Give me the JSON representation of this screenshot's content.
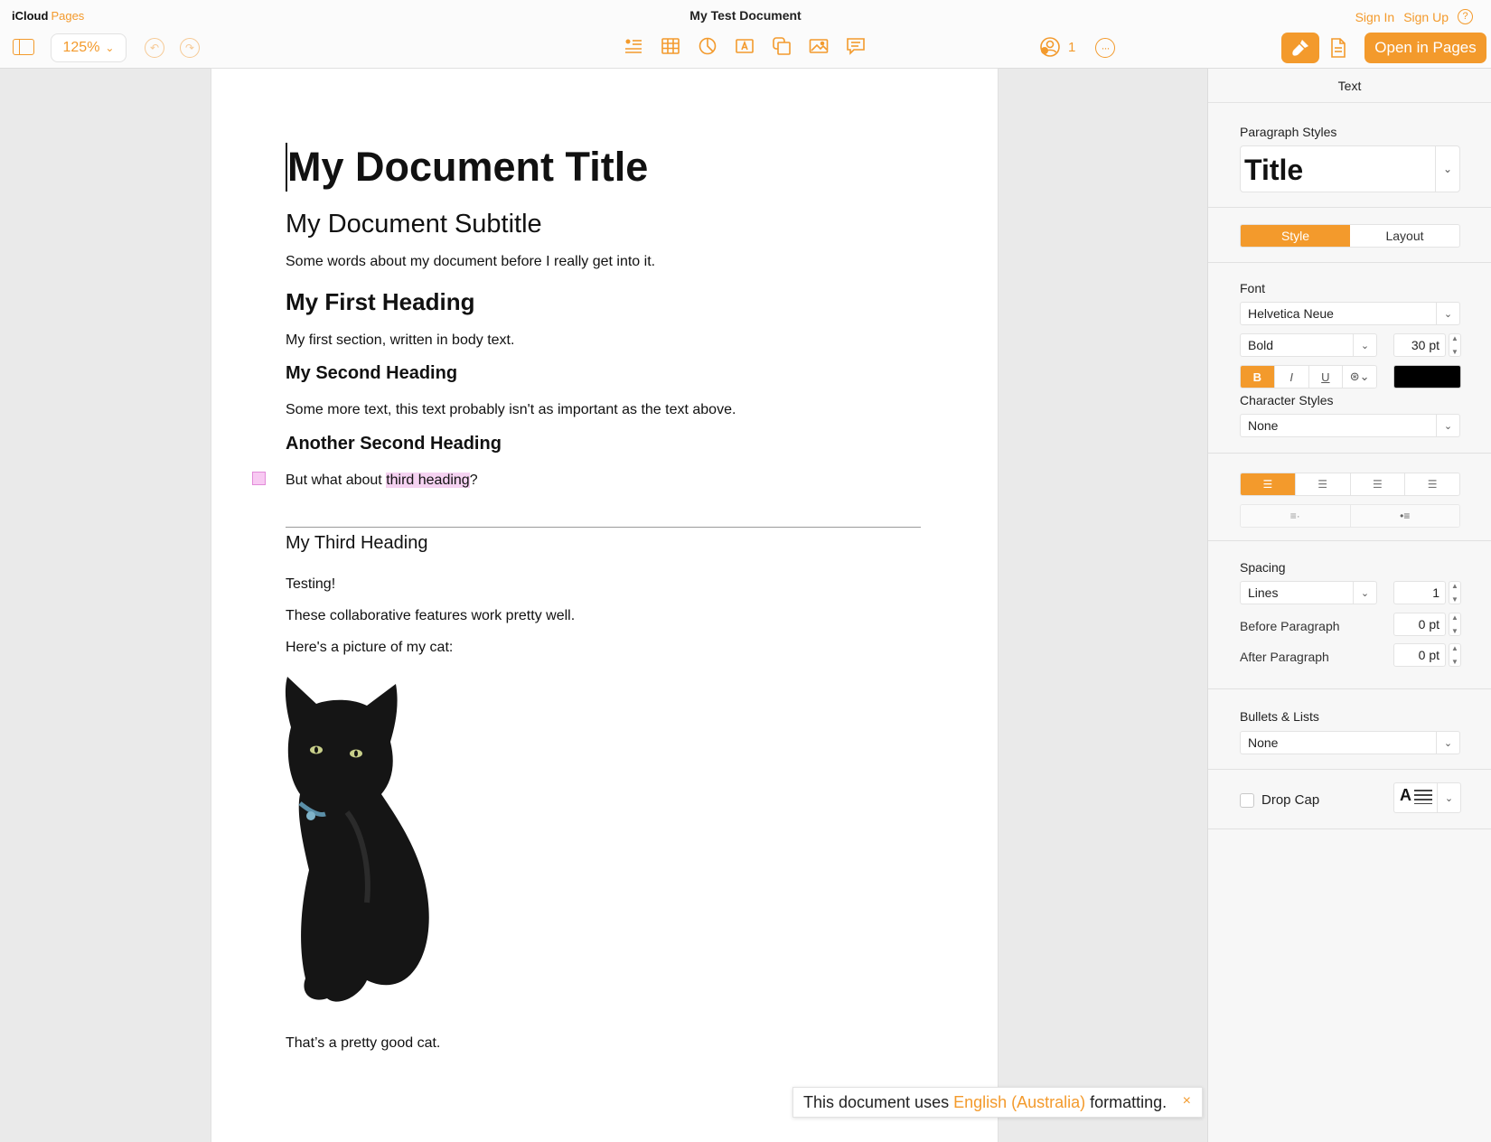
{
  "app": {
    "brand_primary": "iCloud",
    "brand_secondary": "Pages",
    "document_title": "My Test Document",
    "accent_color": "#f39a2c"
  },
  "auth": {
    "sign_in": "Sign In",
    "sign_up": "Sign Up",
    "help_icon": "?"
  },
  "toolbar": {
    "zoom": "125%",
    "collaborator_count": "1",
    "open_button": "Open in Pages",
    "insert_icons": [
      "text-list-icon",
      "table-icon",
      "chart-icon",
      "text-box-icon",
      "shape-icon",
      "media-icon",
      "comment-icon"
    ]
  },
  "document": {
    "title": "My Document Title",
    "subtitle": "My Document Subtitle",
    "intro": "Some words about my document before I really get into it.",
    "heading1": "My First Heading",
    "body1": "My first section, written in body text.",
    "heading2a": "My Second Heading",
    "body2": "Some more text, this text probably isn't as important as the text above.",
    "heading2b": "Another Second Heading",
    "comment_line_prefix": "But what about ",
    "comment_line_highlight": "third heading",
    "comment_line_suffix": "?",
    "heading3": "My Third Heading",
    "line_testing": "Testing!",
    "line_collab": "These collaborative features work pretty well.",
    "line_picture": "Here's a picture of my cat:",
    "line_after": "That’s a pretty good cat."
  },
  "toast": {
    "prefix": "This document uses",
    "locale": "English (Australia)",
    "suffix": "formatting.",
    "close": "×"
  },
  "inspector": {
    "header": "Text",
    "paragraph_styles_label": "Paragraph Styles",
    "paragraph_style": "Title",
    "tabs": {
      "style": "Style",
      "layout": "Layout"
    },
    "font_label": "Font",
    "font_family": "Helvetica Neue",
    "font_weight": "Bold",
    "font_size": "30 pt",
    "bold": "B",
    "italic": "I",
    "underline": "U",
    "text_color": "#000000",
    "character_styles_label": "Character Styles",
    "character_style": "None",
    "spacing_label": "Spacing",
    "spacing_mode": "Lines",
    "spacing_value": "1",
    "before_paragraph_label": "Before Paragraph",
    "before_paragraph_value": "0 pt",
    "after_paragraph_label": "After Paragraph",
    "after_paragraph_value": "0 pt",
    "bullets_label": "Bullets & Lists",
    "bullets_value": "None",
    "drop_cap_label": "Drop Cap",
    "drop_cap_glyph": "A"
  }
}
